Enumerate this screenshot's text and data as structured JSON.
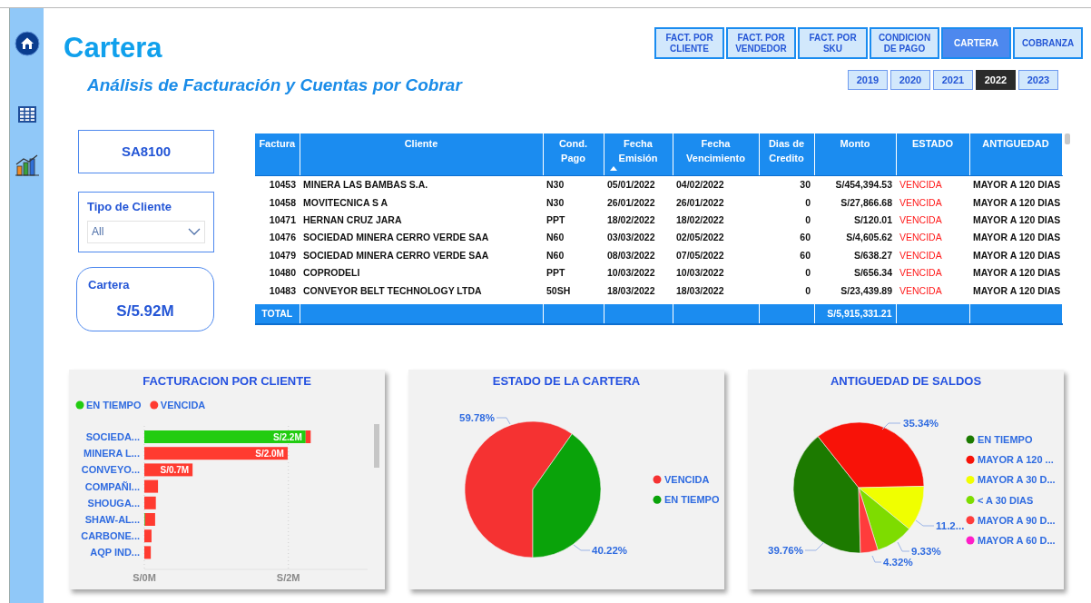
{
  "header": {
    "title": "Cartera",
    "subtitle": "Análisis de Facturación y Cuentas por Cobrar"
  },
  "nav_buttons": [
    {
      "label": "FACT. POR CLIENTE",
      "selected": false
    },
    {
      "label": "FACT. POR VENDEDOR",
      "selected": false
    },
    {
      "label": "FACT. POR SKU",
      "selected": false
    },
    {
      "label": "CONDICION DE PAGO",
      "selected": false
    },
    {
      "label": "CARTERA",
      "selected": true
    },
    {
      "label": "COBRANZA",
      "selected": false
    }
  ],
  "years": [
    {
      "label": "2019",
      "selected": false
    },
    {
      "label": "2020",
      "selected": false
    },
    {
      "label": "2021",
      "selected": false
    },
    {
      "label": "2022",
      "selected": true
    },
    {
      "label": "2023",
      "selected": false
    }
  ],
  "code_card": {
    "value": "SA8100"
  },
  "filter": {
    "label": "Tipo de Cliente",
    "value": "All"
  },
  "kpi": {
    "label": "Cartera",
    "value": "S/5.92M"
  },
  "table": {
    "columns": [
      {
        "label": "Factura",
        "sorted": false
      },
      {
        "label": "Cliente",
        "sorted": false
      },
      {
        "label": "Cond. Pago",
        "sorted": false
      },
      {
        "label": "Fecha Emisión",
        "sorted": true
      },
      {
        "label": "Fecha Vencimiento",
        "sorted": false
      },
      {
        "label": "Dias de Credito",
        "sorted": false
      },
      {
        "label": "Monto",
        "sorted": false
      },
      {
        "label": "ESTADO",
        "sorted": false
      },
      {
        "label": "ANTIGUEDAD",
        "sorted": false
      }
    ],
    "rows": [
      [
        "10453",
        "MINERA LAS BAMBAS S.A.",
        "N30",
        "05/01/2022",
        "04/02/2022",
        "30",
        "S/454,394.53",
        "VENCIDA",
        "MAYOR A 120 DIAS"
      ],
      [
        "10458",
        "MOVITECNICA S A",
        "N30",
        "26/01/2022",
        "26/01/2022",
        "0",
        "S/27,866.68",
        "VENCIDA",
        "MAYOR A 120 DIAS"
      ],
      [
        "10471",
        "HERNAN CRUZ JARA",
        "PPT",
        "18/02/2022",
        "18/02/2022",
        "0",
        "S/120.01",
        "VENCIDA",
        "MAYOR A 120 DIAS"
      ],
      [
        "10476",
        "SOCIEDAD MINERA CERRO VERDE SAA",
        "N60",
        "03/03/2022",
        "02/05/2022",
        "60",
        "S/4,605.62",
        "VENCIDA",
        "MAYOR A 120 DIAS"
      ],
      [
        "10479",
        "SOCIEDAD MINERA CERRO VERDE SAA",
        "N60",
        "08/03/2022",
        "07/05/2022",
        "60",
        "S/638.27",
        "VENCIDA",
        "MAYOR A 120 DIAS"
      ],
      [
        "10480",
        "COPRODELI",
        "PPT",
        "10/03/2022",
        "10/03/2022",
        "0",
        "S/656.34",
        "VENCIDA",
        "MAYOR A 120 DIAS"
      ],
      [
        "10483",
        "CONVEYOR BELT TECHNOLOGY LTDA",
        "50SH",
        "18/03/2022",
        "18/03/2022",
        "0",
        "S/23,439.89",
        "VENCIDA",
        "MAYOR A 120 DIAS"
      ]
    ],
    "total": {
      "label": "TOTAL",
      "amount": "S/5,915,331.21"
    }
  },
  "charts": [
    {
      "chart_data": {
        "type": "bar",
        "title": "FACTURACION POR CLIENTE",
        "orientation": "horizontal",
        "stacked": true,
        "categories": [
          "SOCIEDA...",
          "MINERA L...",
          "CONVEYO...",
          "COMPAÑI...",
          "SHOUGA...",
          "SHAW-AL...",
          "CARBONE...",
          "AQP IND..."
        ],
        "series": [
          {
            "name": "EN TIEMPO",
            "color": "#22cc11",
            "values": [
              2.24,
              0,
              0,
              0,
              0,
              0.01,
              0,
              0
            ]
          },
          {
            "name": "VENCIDA",
            "color": "#ff3b30",
            "values": [
              0.07,
              1.99,
              0.67,
              0.19,
              0.16,
              0.14,
              0.1,
              0.09
            ]
          }
        ],
        "xticks": [
          {
            "value": 0,
            "label": "S/0M"
          },
          {
            "value": 2,
            "label": "S/2M"
          }
        ],
        "xlim": [
          0,
          3.1
        ],
        "legend": true,
        "annotations": [
          {
            "text": "S/2.2M",
            "x": 2.24,
            "y": "SOCIEDA..."
          },
          {
            "text": "S/2.0M",
            "x": 1.99,
            "y": "MINERA L..."
          },
          {
            "text": "S/0.7M",
            "x": 0.67,
            "y": "CONVEYO..."
          }
        ]
      }
    },
    {
      "chart_data": {
        "type": "pie",
        "title": "ESTADO DE LA CARTERA",
        "categories": [
          "VENCIDA",
          "EN TIEMPO"
        ],
        "values": [
          59.78,
          40.22
        ],
        "colors": [
          "#f53232",
          "#0aa30a"
        ],
        "legend": true,
        "value_labels": [
          "59.78%",
          "40.22%"
        ]
      }
    },
    {
      "chart_data": {
        "type": "pie",
        "title": "ANTIGUEDAD DE SALDOS",
        "categories": [
          "EN TIEMPO",
          "MAYOR A 120 ...",
          "MAYOR A 30 D...",
          "< A 30 DIAS",
          "MAYOR A 90 D...",
          "MAYOR A 60 D..."
        ],
        "values": [
          39.76,
          35.34,
          11.25,
          9.33,
          4.32,
          0
        ],
        "colors": [
          "#1c7a00",
          "#f81208",
          "#f0ff00",
          "#7edc00",
          "#ff3c3c",
          "#ff1ec8"
        ],
        "legend": true,
        "value_labels": [
          "39.76%",
          "35.34%",
          "11.2...",
          "9.33%",
          "4.32%",
          null
        ]
      }
    }
  ]
}
